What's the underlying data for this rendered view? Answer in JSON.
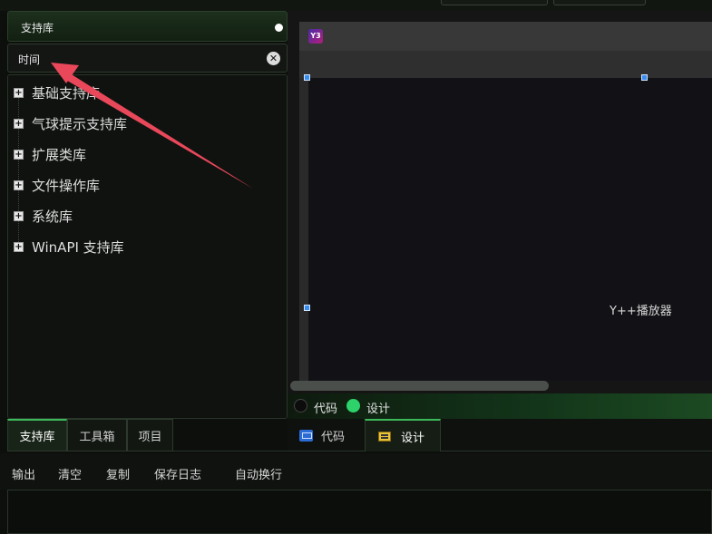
{
  "library_panel": {
    "header_title": "支持库",
    "search_value": "时间",
    "clear_glyph": "✕",
    "tree_items": [
      {
        "expander": "+",
        "label": "基础支持库"
      },
      {
        "expander": "+",
        "label": "气球提示支持库"
      },
      {
        "expander": "+",
        "label": "扩展类库"
      },
      {
        "expander": "+",
        "label": "文件操作库"
      },
      {
        "expander": "+",
        "label": "系统库"
      },
      {
        "expander": "+",
        "label": "WinAPI 支持库"
      }
    ],
    "tabs": [
      "支持库",
      "工具箱",
      "项目"
    ]
  },
  "designer": {
    "window_icon": "Y3",
    "component_label": "Y++播放器",
    "mode_options": [
      "代码",
      "设计"
    ],
    "selected_mode": "设计"
  },
  "editor_tabs": {
    "code_label": "代码",
    "design_label": "设计"
  },
  "output_toolbar": {
    "buttons": [
      "输出",
      "清空",
      "复制",
      "保存日志",
      "自动换行"
    ]
  },
  "colors": {
    "accent_green": "#3cba5a",
    "radio_on": "#2dd26a",
    "handle_blue": "#3a8ef0",
    "annotation_arrow": "#e8485a"
  },
  "icons": {
    "header_status": "white-dot-icon",
    "search_clear": "clear-icon",
    "expander": "plus-box-icon",
    "code_tab": "monitor-code-icon",
    "design_tab": "design-form-icon"
  }
}
